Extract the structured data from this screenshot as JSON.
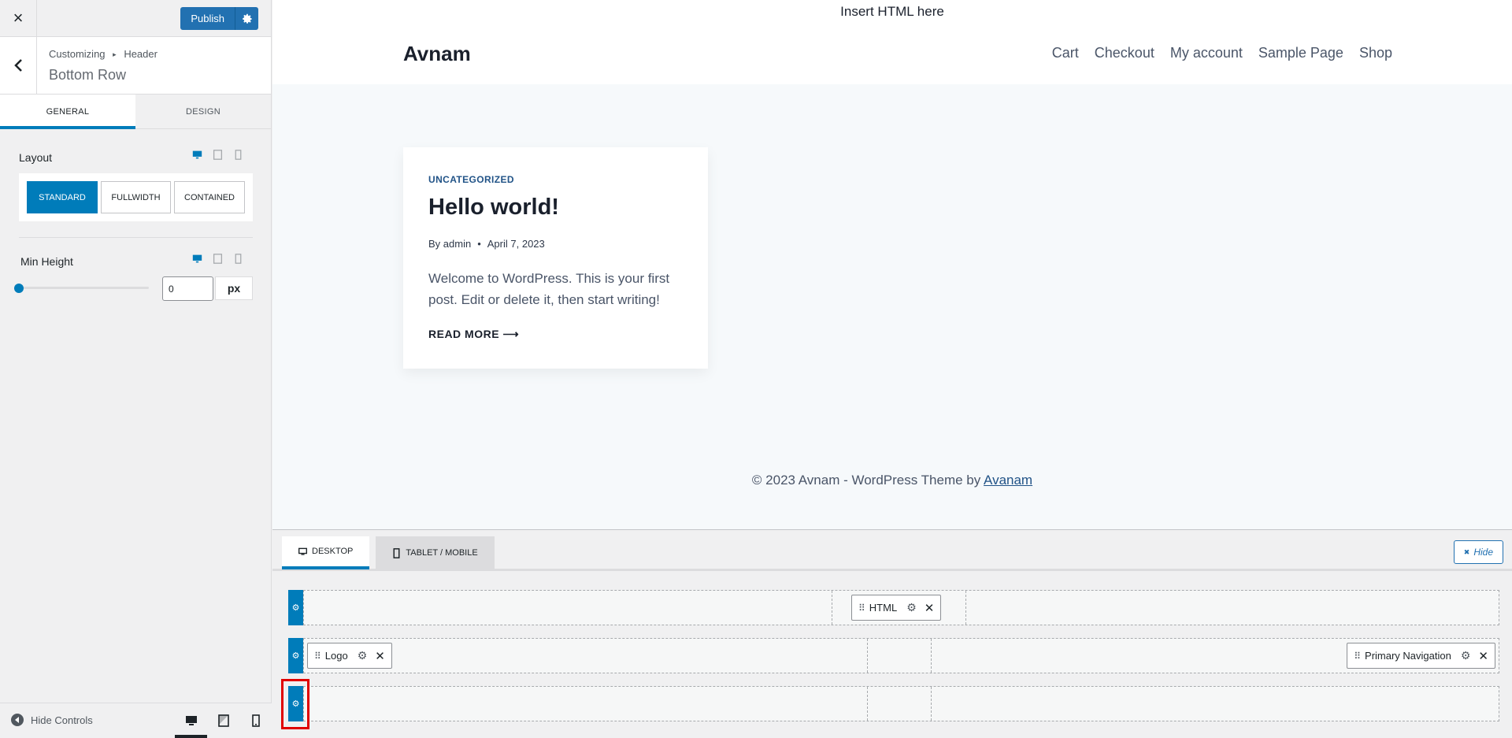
{
  "panel": {
    "close_icon": "×",
    "publish_label": "Publish",
    "breadcrumb_root": "Customizing",
    "breadcrumb_sep": "▸",
    "breadcrumb_section": "Header",
    "section_title": "Bottom Row",
    "tabs": [
      {
        "label": "GENERAL",
        "active": true
      },
      {
        "label": "DESIGN",
        "active": false
      }
    ],
    "layout": {
      "label": "Layout",
      "options": [
        "STANDARD",
        "FULLWIDTH",
        "CONTAINED"
      ],
      "selected": "STANDARD"
    },
    "min_height": {
      "label": "Min Height",
      "value": "0",
      "unit": "px",
      "slider_fraction": 0
    },
    "footer": {
      "hide_label": "Hide Controls",
      "active_device": "desktop"
    }
  },
  "preview": {
    "topbar_text": "Insert HTML here",
    "site_title": "Avnam",
    "nav": [
      "Cart",
      "Checkout",
      "My account",
      "Sample Page",
      "Shop"
    ],
    "post": {
      "category": "UNCATEGORIZED",
      "title": "Hello world!",
      "author": "By admin",
      "bullet": "•",
      "date": "April 7, 2023",
      "excerpt": "Welcome to WordPress. This is your first post. Edit or delete it, then start writing!",
      "read_more": "READ MORE",
      "read_more_arrow": "⟶"
    },
    "footer_text": "© 2023 Avnam - WordPress Theme by ",
    "footer_link": "Avanam"
  },
  "builder": {
    "tabs": [
      {
        "label": "DESKTOP",
        "active": true
      },
      {
        "label": "TABLET / MOBILE",
        "active": false
      }
    ],
    "hide_label": "Hide",
    "hide_icon": "✖",
    "rows": [
      {
        "name": "top",
        "items": [
          {
            "label": "HTML"
          }
        ]
      },
      {
        "name": "main",
        "items": [
          {
            "label": "Logo"
          },
          {
            "label": "Primary Navigation"
          }
        ]
      },
      {
        "name": "bottom",
        "items": []
      }
    ]
  },
  "colors": {
    "accent": "#007cba",
    "publish": "#2271b1",
    "highlight": "#e00000"
  }
}
